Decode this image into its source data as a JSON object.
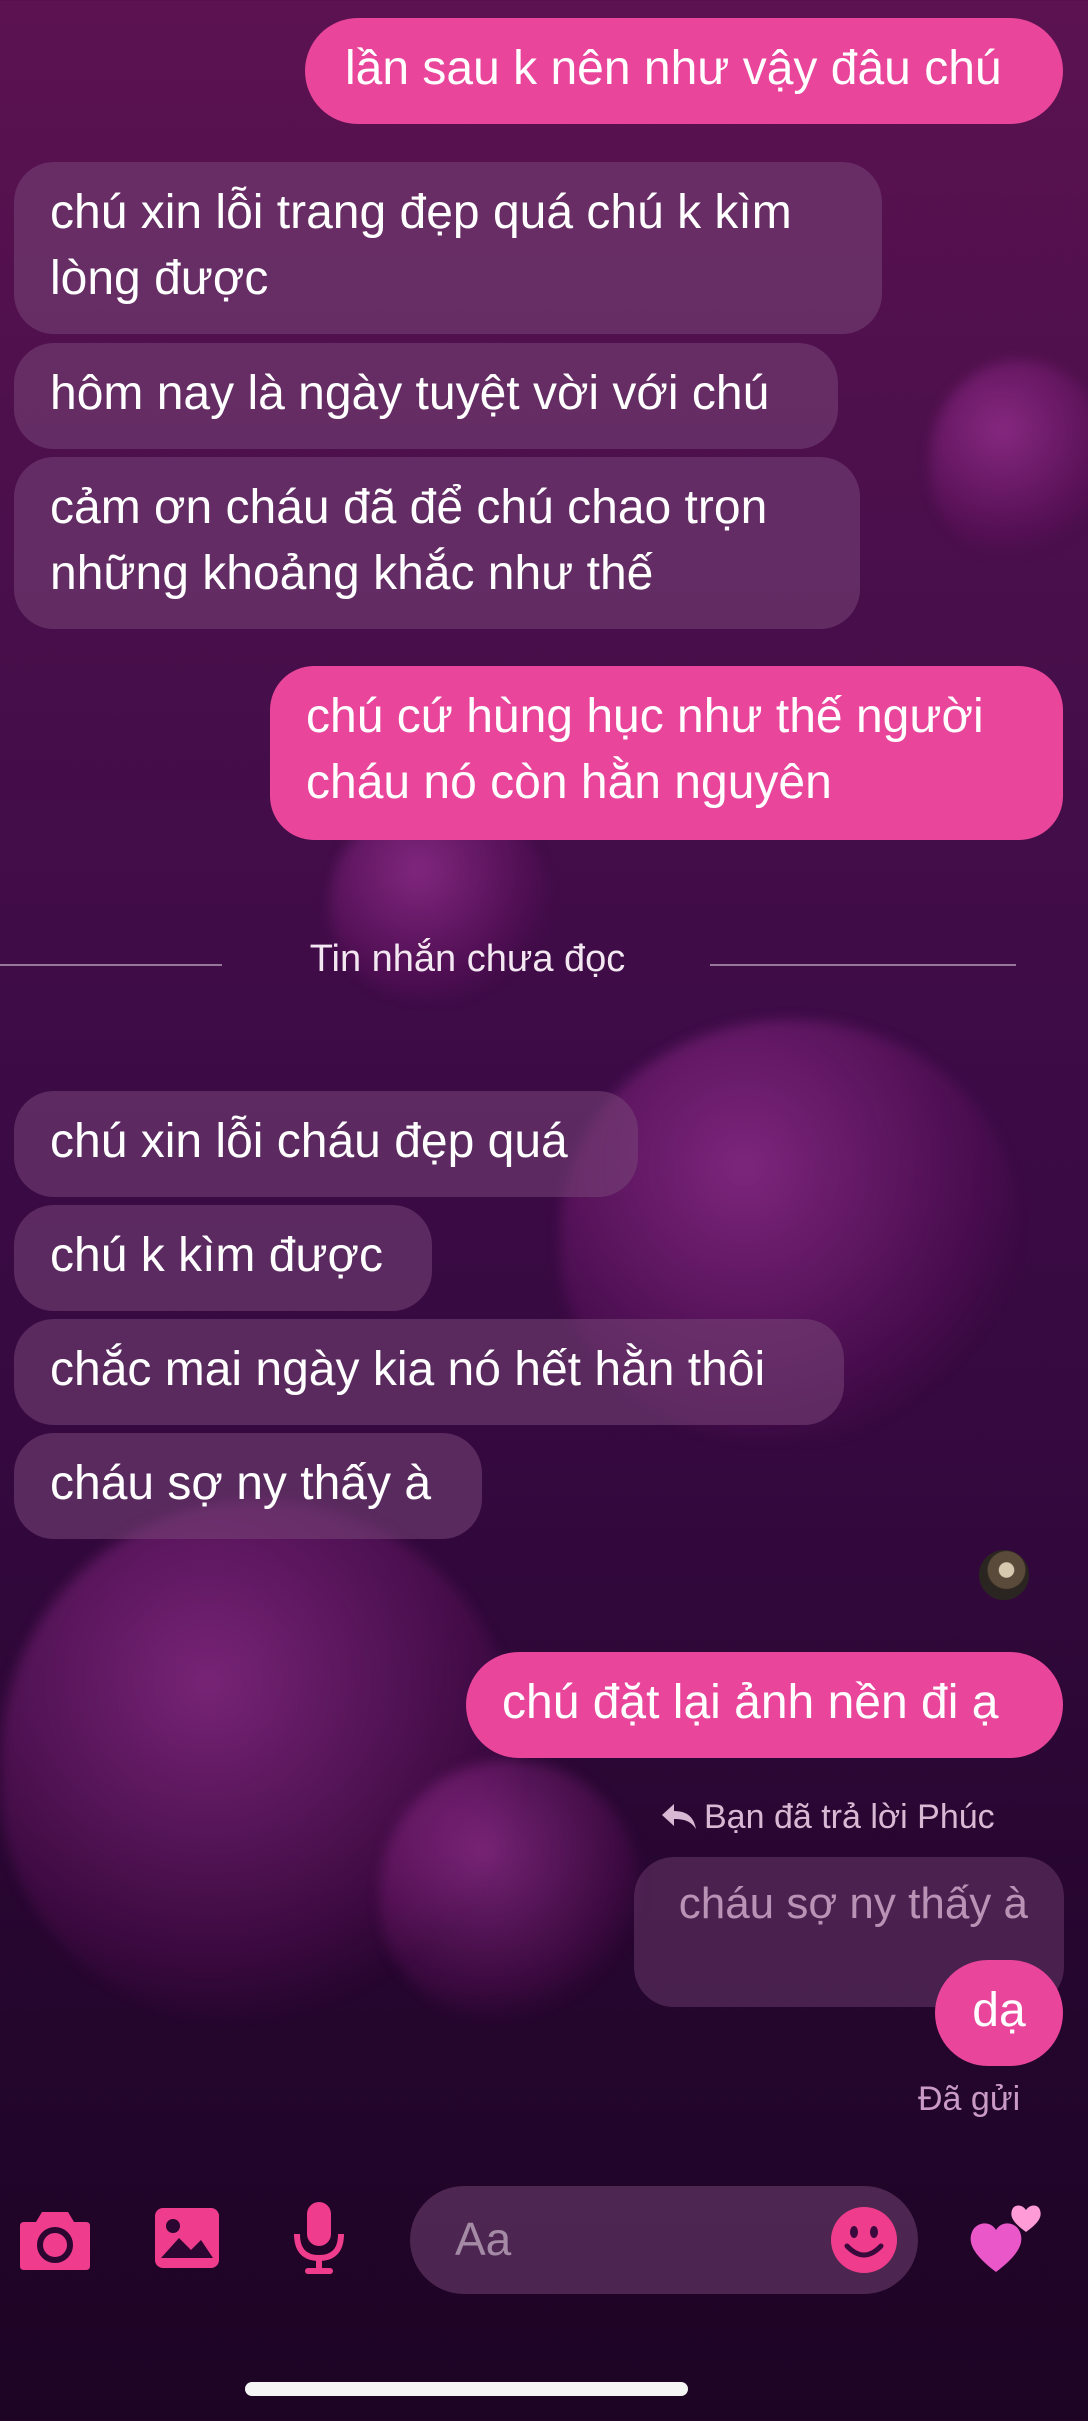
{
  "messages": [
    {
      "text": "lần sau k nên như vậy đâu chú"
    },
    {
      "text": "chú xin lỗi trang đẹp quá chú k kìm lòng được"
    },
    {
      "text": "hôm nay là ngày tuyệt vời với chú"
    },
    {
      "text": "cảm ơn cháu đã để chú chao trọn những khoảng khắc như thế"
    },
    {
      "text": "chú cứ hùng hục như thế người cháu nó còn hằn nguyên"
    },
    {
      "text": "chú xin lỗi cháu đẹp quá"
    },
    {
      "text": "chú k kìm được"
    },
    {
      "text": "chắc mai ngày kia nó hết hằn thôi"
    },
    {
      "text": "cháu sợ ny thấy à"
    },
    {
      "text": "chú đặt lại ảnh nền đi ạ"
    },
    {
      "text": "dạ"
    }
  ],
  "unread_divider": "Tin nhắn chưa đọc",
  "reply": {
    "header": "Bạn đã trả lời Phúc",
    "quoted": "cháu sợ ny thấy à"
  },
  "status": "Đã gửi",
  "composer": {
    "placeholder": "Aa"
  },
  "icons": {
    "camera": "camera-icon",
    "gallery": "image-icon",
    "mic": "microphone-icon",
    "emoji": "smiley-icon",
    "reaction": "hearts-emoji-icon",
    "reply": "reply-arrow-icon"
  },
  "colors": {
    "accent": "#e9459b",
    "icon": "#f03c8c"
  }
}
